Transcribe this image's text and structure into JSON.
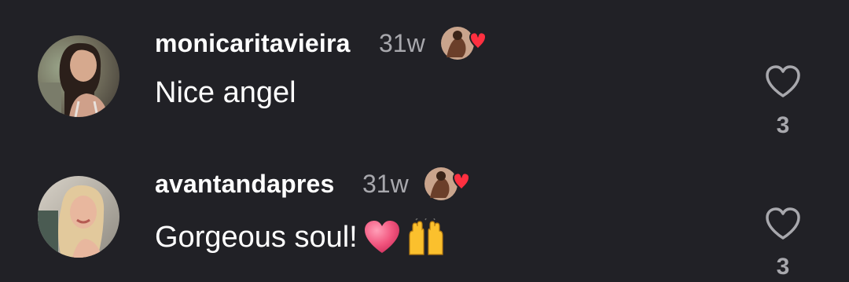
{
  "comments": [
    {
      "username": "monicaritavieira",
      "time": "31w",
      "text": "Nice angel",
      "likes": "3",
      "creator_liked": true,
      "emojis": []
    },
    {
      "username": "avantandapres",
      "time": "31w",
      "text": "Gorgeous soul!",
      "likes": "3",
      "creator_liked": true,
      "emojis": [
        "pink-heart",
        "raising-hands"
      ]
    }
  ],
  "colors": {
    "background": "#212126",
    "primary_text": "#ffffff",
    "secondary_text": "#a8a8ad",
    "heart_red": "#ff3040"
  },
  "icons": {
    "like": "heart-outline-icon",
    "creator_liked": "creator-liked-heart-icon"
  }
}
